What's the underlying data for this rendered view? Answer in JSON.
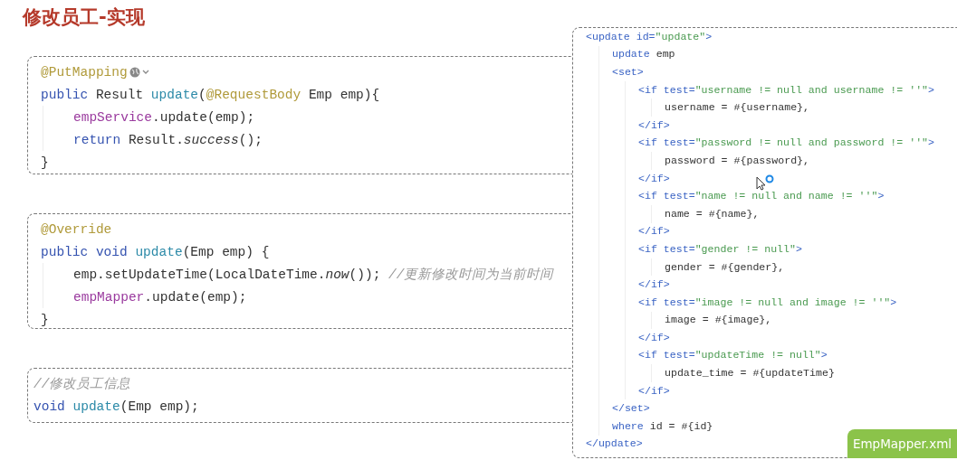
{
  "title": "修改员工-实现",
  "controller": [
    {
      "kind": "mapping",
      "tokens": [
        {
          "kind": "ann",
          "t": "@PutMapping"
        }
      ]
    },
    {
      "tokens": [
        {
          "kind": "kw",
          "t": "public "
        },
        {
          "kind": "pl",
          "t": "Result "
        },
        {
          "kind": "fn",
          "t": "update"
        },
        {
          "kind": "pl",
          "t": "("
        },
        {
          "kind": "ann",
          "t": "@RequestBody "
        },
        {
          "kind": "pl",
          "t": "Emp emp){"
        }
      ],
      "children": [
        {
          "tokens": [
            {
              "kind": "field",
              "t": "empService"
            },
            {
              "kind": "pl",
              "t": ".update(emp);"
            }
          ]
        },
        {
          "tokens": [
            {
              "kind": "kw",
              "t": "return "
            },
            {
              "kind": "pl",
              "t": "Result."
            },
            {
              "kind": "it",
              "t": "success"
            },
            {
              "kind": "pl",
              "t": "();"
            }
          ]
        }
      ]
    },
    {
      "tokens": [
        {
          "kind": "pl",
          "t": "}"
        }
      ]
    }
  ],
  "service": [
    {
      "tokens": [
        {
          "kind": "ann",
          "t": "@Override"
        }
      ]
    },
    {
      "tokens": [
        {
          "kind": "kw",
          "t": "public void "
        },
        {
          "kind": "fn",
          "t": "update"
        },
        {
          "kind": "pl",
          "t": "(Emp emp) {"
        }
      ],
      "children": [
        {
          "tokens": [
            {
              "kind": "pl",
              "t": "emp.setUpdateTime(LocalDateTime."
            },
            {
              "kind": "it",
              "t": "now"
            },
            {
              "kind": "pl",
              "t": "()); "
            },
            {
              "kind": "cm",
              "t": "//更新修改时间为当前时间"
            }
          ]
        },
        {
          "tokens": [
            {
              "kind": "field",
              "t": "empMapper"
            },
            {
              "kind": "pl",
              "t": ".update(emp);"
            }
          ]
        }
      ]
    },
    {
      "tokens": [
        {
          "kind": "pl",
          "t": "}"
        }
      ]
    }
  ],
  "mapper": [
    {
      "tokens": [
        {
          "kind": "cm",
          "t": "//修改员工信息"
        }
      ]
    },
    {
      "tokens": [
        {
          "kind": "kw",
          "t": "void "
        },
        {
          "kind": "fn",
          "t": "update"
        },
        {
          "kind": "pl",
          "t": "(Emp emp);"
        }
      ]
    }
  ],
  "xml": {
    "label": "EmpMapper.xml",
    "lines": [
      {
        "tokens": [
          {
            "kind": "tag",
            "t": "<update "
          },
          {
            "kind": "attr",
            "t": "id="
          },
          {
            "kind": "str",
            "t": "\"update\""
          },
          {
            "kind": "tag",
            "t": ">"
          }
        ],
        "children": [
          {
            "tokens": [
              {
                "kind": "tag",
                "t": "update "
              },
              {
                "kind": "pl",
                "t": "emp"
              }
            ]
          },
          {
            "tokens": [
              {
                "kind": "tag",
                "t": "<set>"
              }
            ],
            "children": [
              {
                "tokens": [
                  {
                    "kind": "tag",
                    "t": "<if "
                  },
                  {
                    "kind": "attr",
                    "t": "test="
                  },
                  {
                    "kind": "str",
                    "t": "\"username != null and username != ''\""
                  },
                  {
                    "kind": "tag",
                    "t": ">"
                  }
                ],
                "children": [
                  {
                    "tokens": [
                      {
                        "kind": "pl",
                        "t": "username = #{username},"
                      }
                    ]
                  }
                ]
              },
              {
                "tokens": [
                  {
                    "kind": "tag",
                    "t": "</if>"
                  }
                ]
              },
              {
                "tokens": [
                  {
                    "kind": "tag",
                    "t": "<if "
                  },
                  {
                    "kind": "attr",
                    "t": "test="
                  },
                  {
                    "kind": "str",
                    "t": "\"password != null and password != ''\""
                  },
                  {
                    "kind": "tag",
                    "t": ">"
                  }
                ],
                "children": [
                  {
                    "tokens": [
                      {
                        "kind": "pl",
                        "t": "password = #{password},"
                      }
                    ]
                  }
                ]
              },
              {
                "tokens": [
                  {
                    "kind": "tag",
                    "t": "</if>"
                  }
                ]
              },
              {
                "tokens": [
                  {
                    "kind": "tag",
                    "t": "<if "
                  },
                  {
                    "kind": "attr",
                    "t": "test="
                  },
                  {
                    "kind": "str",
                    "t": "\"name != null and name != ''\""
                  },
                  {
                    "kind": "tag",
                    "t": ">"
                  }
                ],
                "children": [
                  {
                    "tokens": [
                      {
                        "kind": "pl",
                        "t": "name = #{name},"
                      }
                    ]
                  }
                ]
              },
              {
                "tokens": [
                  {
                    "kind": "tag",
                    "t": "</if>"
                  }
                ]
              },
              {
                "tokens": [
                  {
                    "kind": "tag",
                    "t": "<if "
                  },
                  {
                    "kind": "attr",
                    "t": "test="
                  },
                  {
                    "kind": "str",
                    "t": "\"gender != null\""
                  },
                  {
                    "kind": "tag",
                    "t": ">"
                  }
                ],
                "children": [
                  {
                    "tokens": [
                      {
                        "kind": "pl",
                        "t": "gender = #{gender},"
                      }
                    ]
                  }
                ]
              },
              {
                "tokens": [
                  {
                    "kind": "tag",
                    "t": "</if>"
                  }
                ]
              },
              {
                "tokens": [
                  {
                    "kind": "tag",
                    "t": "<if "
                  },
                  {
                    "kind": "attr",
                    "t": "test="
                  },
                  {
                    "kind": "str",
                    "t": "\"image != null and image != ''\""
                  },
                  {
                    "kind": "tag",
                    "t": ">"
                  }
                ],
                "children": [
                  {
                    "tokens": [
                      {
                        "kind": "pl",
                        "t": "image = #{image},"
                      }
                    ]
                  }
                ]
              },
              {
                "tokens": [
                  {
                    "kind": "tag",
                    "t": "</if>"
                  }
                ]
              },
              {
                "tokens": [
                  {
                    "kind": "tag",
                    "t": "<if "
                  },
                  {
                    "kind": "attr",
                    "t": "test="
                  },
                  {
                    "kind": "str",
                    "t": "\"updateTime != null\""
                  },
                  {
                    "kind": "tag",
                    "t": ">"
                  }
                ],
                "children": [
                  {
                    "tokens": [
                      {
                        "kind": "pl",
                        "t": "update_time = #{updateTime}"
                      }
                    ]
                  }
                ]
              },
              {
                "tokens": [
                  {
                    "kind": "tag",
                    "t": "</if>"
                  }
                ]
              }
            ]
          },
          {
            "tokens": [
              {
                "kind": "tag",
                "t": "</set>"
              }
            ]
          },
          {
            "tokens": [
              {
                "kind": "tag",
                "t": "where "
              },
              {
                "kind": "pl",
                "t": "id = #{id}"
              }
            ]
          }
        ]
      },
      {
        "tokens": [
          {
            "kind": "tag",
            "t": "</update>"
          }
        ]
      }
    ]
  }
}
